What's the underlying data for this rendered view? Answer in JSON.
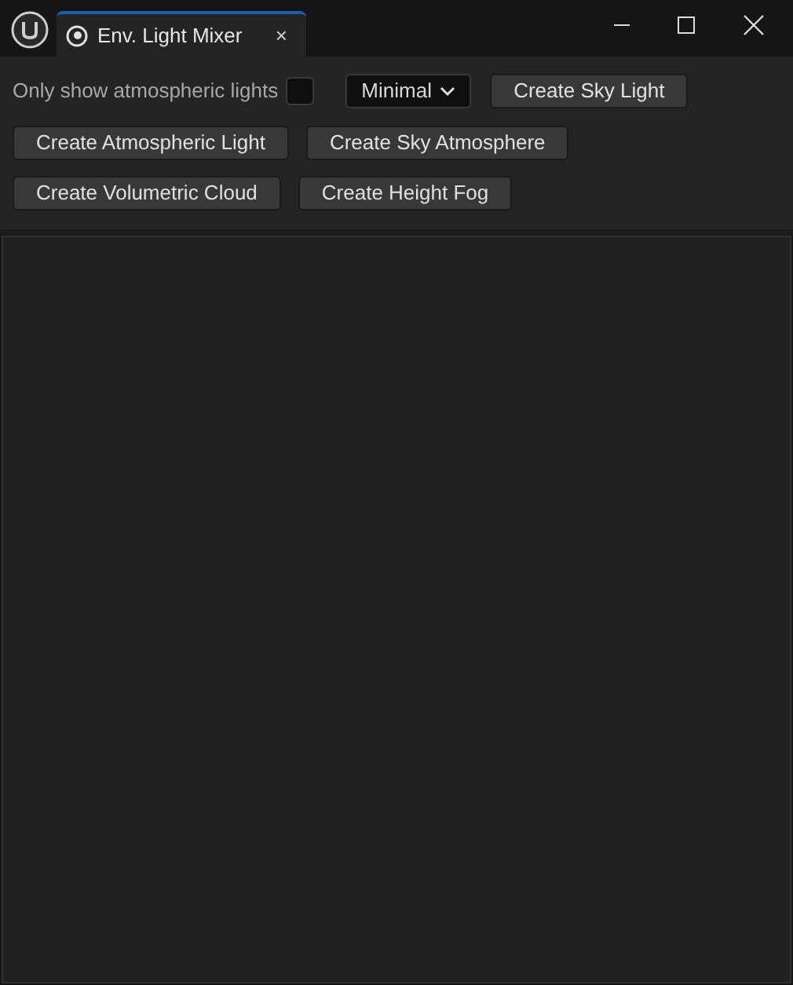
{
  "window": {
    "tab": {
      "title": "Env. Light Mixer",
      "close": "×",
      "selected": true
    }
  },
  "toolbar": {
    "checkbox": {
      "label": "Only show atmospheric lights",
      "checked": false
    },
    "dropdown": {
      "value": "Minimal"
    },
    "buttons": [
      [
        "Create Sky Light"
      ],
      [
        "Create Atmospheric Light",
        "Create Sky Atmosphere"
      ],
      [
        "Create Volumetric Cloud",
        "Create Height Fog"
      ]
    ]
  }
}
